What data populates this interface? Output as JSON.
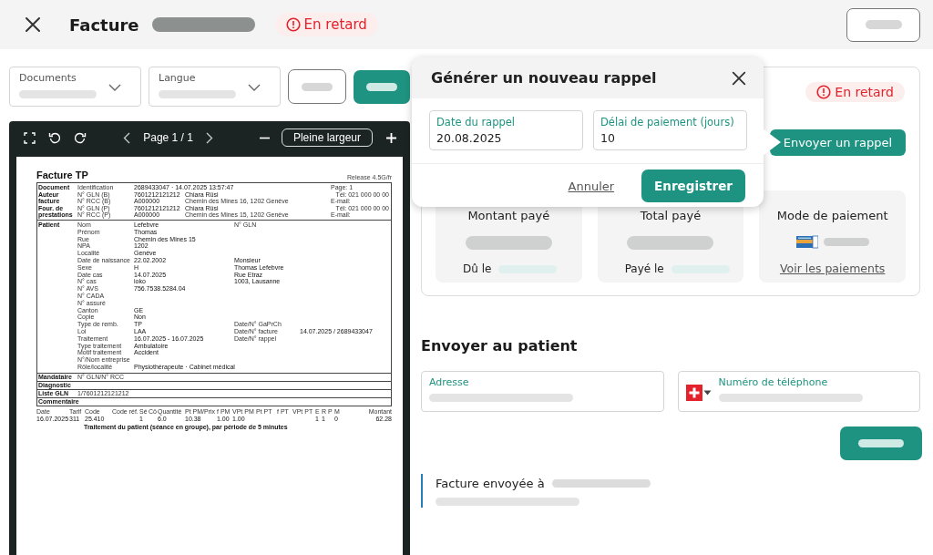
{
  "topbar": {
    "title": "Facture",
    "status": "En retard"
  },
  "toolbar": {
    "selects": [
      {
        "label": "Documents"
      },
      {
        "label": "Langue"
      }
    ]
  },
  "viewer": {
    "page": "Page 1 / 1",
    "fit_button": "Pleine largeur"
  },
  "invoice": {
    "title": "Facture TP",
    "release": "Release 4.5G/fr",
    "header_rows": [
      {
        "section": "Document",
        "label": "Identification",
        "value": "2689433047 · 14.07.2025 13:57:47",
        "right": "Page: 1"
      },
      {
        "section": "Auteur",
        "label": "N° GLN (B)",
        "value": "7601212121212",
        "detail": "Chiara Rüsi",
        "right": "Tél: 021 000 00 00"
      },
      {
        "section": "facture",
        "label": "N° RCC (B)",
        "value": "A000000",
        "detail": "Chemin des Mines 16, 1202 Genève",
        "right": "E-mail:"
      },
      {
        "section": "Four. de",
        "label": "N° GLN (P)",
        "value": "7601212121212",
        "detail": "Chiara Rüsi",
        "right": "Tél: 021 000 00 00"
      },
      {
        "section": "prestations",
        "label": "N° RCC (P)",
        "value": "A000000",
        "detail": "Chemin des Mines 15, 1202 Genève",
        "right": "E-mail:"
      }
    ],
    "patient_section": "Patient",
    "patient_rows": [
      {
        "label": "Nom",
        "value": "Lefebvre",
        "side_label": "N° GLN"
      },
      {
        "label": "Prénom",
        "value": "Thomas"
      },
      {
        "label": "Rue",
        "value": "Chemin des Mines 15"
      },
      {
        "label": "NPA",
        "value": "1202"
      },
      {
        "label": "Localité",
        "value": "Genève"
      },
      {
        "label": "Date de naissance",
        "value": "22.02.2002",
        "address_line": "Monsieur"
      },
      {
        "label": "Sexe",
        "value": "H",
        "address_line": "Thomas Lefebvre"
      },
      {
        "label": "Date cas",
        "value": "14.07.2025",
        "address_line": "Rue Etraz"
      },
      {
        "label": "N° cas",
        "value": "ioko",
        "address_line": "1003, Lausanne"
      },
      {
        "label": "N° AVS",
        "value": "756.7538.5284.04"
      },
      {
        "label": "N° CADA"
      },
      {
        "label": "N° assuré"
      },
      {
        "label": "Canton",
        "value": "GE"
      },
      {
        "label": "Copie",
        "value": "Non"
      },
      {
        "label": "Type de remb.",
        "value": "TP",
        "side_label": "Date/N° GaPrCh"
      },
      {
        "label": "Loi",
        "value": "LAA",
        "side_label": "Date/N° facture",
        "side_value": "14.07.2025 / 2689433047"
      },
      {
        "label": "Traitement",
        "value": "16.07.2025 - 16.07.2025",
        "side_label": "Date/N° rappel"
      },
      {
        "label": "Type traitement",
        "value": "Ambulatoire"
      },
      {
        "label": "Motif traitement",
        "value": "Accident"
      },
      {
        "label": "N°/Nom entreprise"
      },
      {
        "label": "Rôle/localité",
        "value": "Physiothérapeute · Cabinet médical"
      }
    ],
    "boxes": [
      {
        "section": "Mandataire",
        "label": "N° GLN/N° RCC"
      },
      {
        "section": "Diagnostic"
      },
      {
        "section": "Liste GLN",
        "label": "1/7601212121212"
      },
      {
        "section": "Commentaire"
      }
    ],
    "services": {
      "columns": [
        "Date",
        "Tarif",
        "Code",
        "Code réf.",
        "Sé",
        "Cô",
        "Quantité",
        "Pt PM/Prix",
        "f PM",
        "VPt PM",
        "Pt PT",
        "f PT",
        "VPt PT",
        "E",
        "R",
        "P",
        "M",
        "Montant"
      ],
      "rows": [
        {
          "cells": [
            "16.07.2025",
            "311",
            "25.410",
            null,
            "1",
            null,
            "6.0",
            "10.38",
            "1.00",
            "1.00",
            null,
            null,
            null,
            "1",
            "1",
            null,
            "0",
            "62.28"
          ],
          "description": "Traitement du patient (séance en groupe), par période de 5 minutes"
        }
      ]
    }
  },
  "reminder_card": {
    "status": "En retard",
    "send_button": "Envoyer un rappel",
    "tiles": [
      {
        "kind": "amount",
        "title": "Montant payé",
        "footer": "Dû le"
      },
      {
        "kind": "amount",
        "title": "Total payé",
        "footer": "Payé le"
      },
      {
        "kind": "payment",
        "title": "Mode de paiement",
        "link": "Voir les paiements"
      }
    ]
  },
  "send_to_patient": {
    "heading": "Envoyer au patient",
    "address_label": "Adresse",
    "phone_label": "Numéro de téléphone",
    "history_label": "Facture envoyée à"
  },
  "popup": {
    "title": "Générer un nouveau rappel",
    "fields": [
      {
        "label": "Date du rappel",
        "value": "20.08.2025"
      },
      {
        "label": "Délai de paiement (jours)",
        "value": "10"
      }
    ],
    "cancel": "Annuler",
    "save": "Enregistrer"
  }
}
